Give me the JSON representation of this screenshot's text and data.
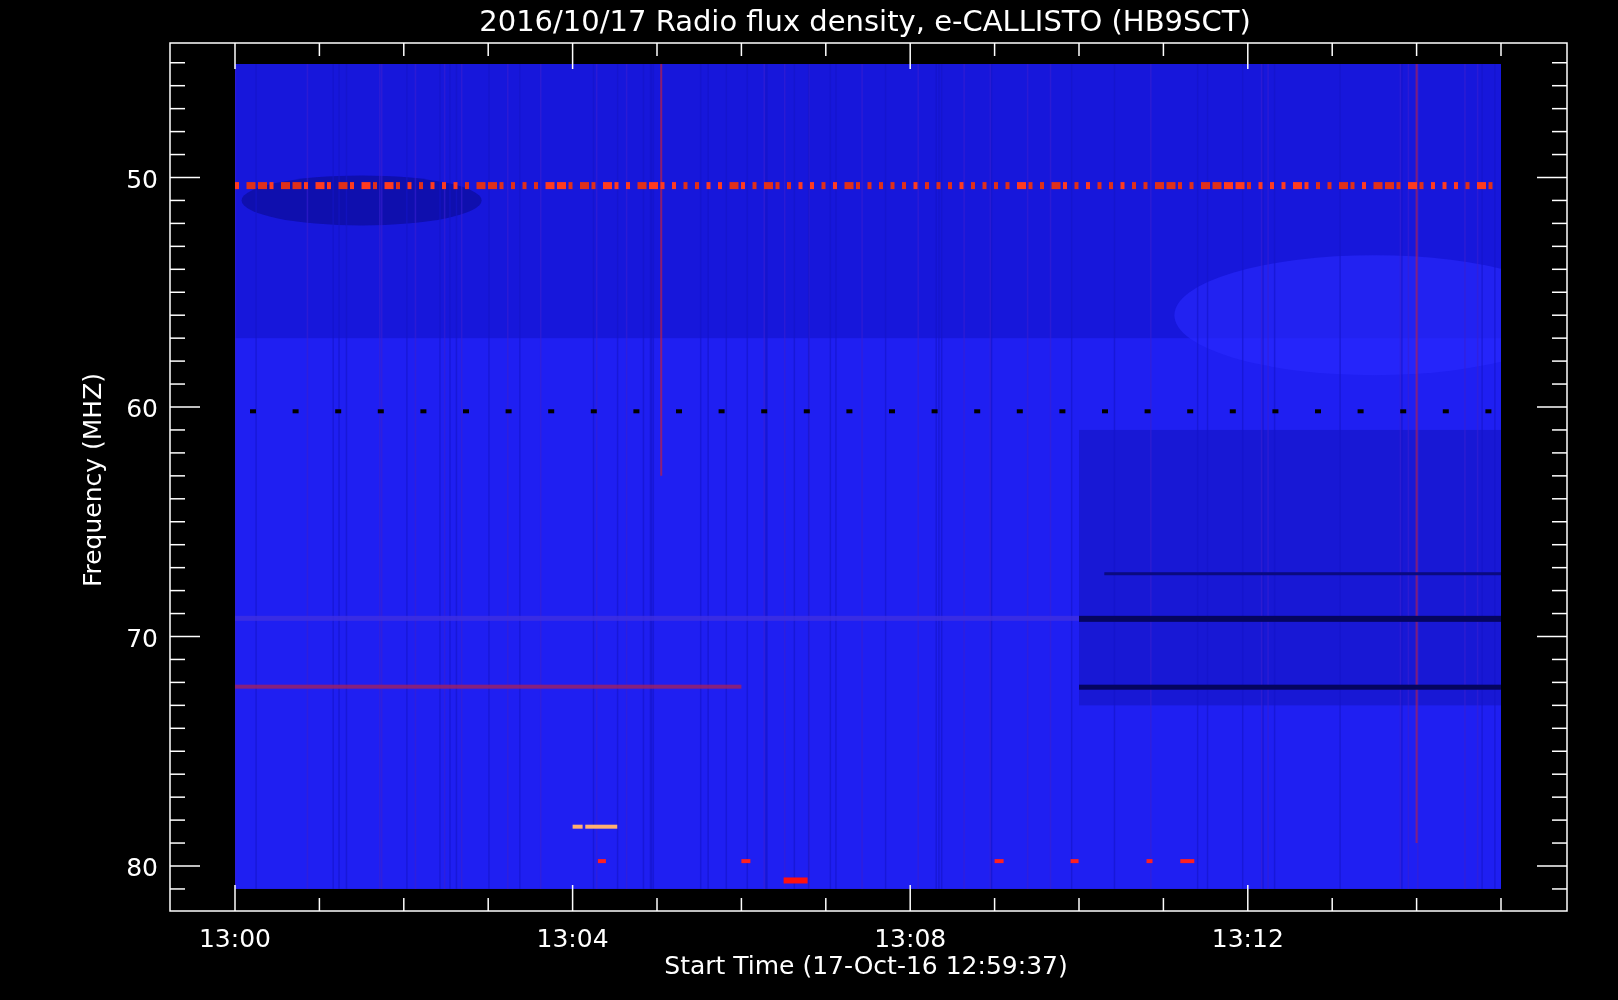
{
  "chart": {
    "title": "2016/10/17  Radio flux density, e-CALLISTO (HB9SCT)",
    "ylabel": "Frequency (MHZ)",
    "xlabel": "Start Time (17-Oct-16 12:59:37)",
    "yticks": [
      "50",
      "60",
      "70",
      "80"
    ],
    "xticks": [
      "13:00",
      "13:04",
      "13:08",
      "13:12"
    ]
  }
}
